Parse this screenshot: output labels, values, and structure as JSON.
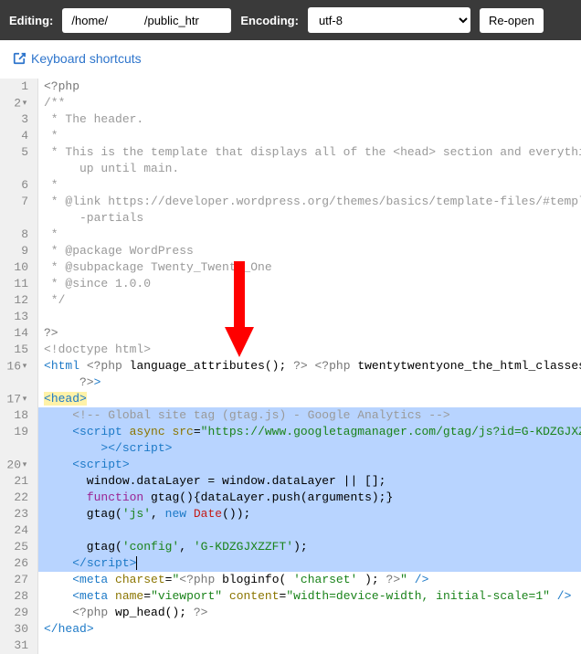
{
  "toolbar": {
    "editing_label": "Editing:",
    "path_value": "/home/           /public_htr",
    "encoding_label": "Encoding:",
    "encoding_value": "utf-8",
    "reopen_label": "Re-open"
  },
  "shortcuts_link": "Keyboard shortcuts",
  "code": {
    "l1": "<?php",
    "l2": "/**",
    "l3": " * The header.",
    "l4": " *",
    "l5": " * This is the template that displays all of the <head> section and everything",
    "l5b": "     up until main.",
    "l6": " *",
    "l7": " * @link https://developer.wordpress.org/themes/basics/template-files/#template",
    "l7b": "     -partials",
    "l8": " *",
    "l9": " * @package WordPress",
    "l10": " * @subpackage Twenty_Twenty_One",
    "l11": " * @since 1.0.0",
    "l12": " */",
    "l13": "",
    "l14": "?>",
    "l15": "<!doctype html>",
    "l16a": "<",
    "l16b": "html ",
    "l16c": "<?php",
    "l16d": " language_attributes(); ",
    "l16e": "?>",
    "l16f": " ",
    "l16g": "<?php",
    "l16h": " twentytwentyone_the_html_classes();",
    "l16i": "     ?>",
    "l16j": ">",
    "l17a": "<",
    "l17b": "head",
    "l17c": ">",
    "l18": "    <!-- Global site tag (gtag.js) - Google Analytics -->",
    "l19a": "    <",
    "l19b": "script ",
    "l19c": "async ",
    "l19d": "src",
    "l19e": "=",
    "l19f": "\"https://www.googletagmanager.com/gtag/js?id=G-KDZGJXZZFT\"",
    "l19g": "        ></",
    "l19h": "script",
    "l19i": ">",
    "l20a": "    <",
    "l20b": "script",
    "l20c": ">",
    "l21": "      window.dataLayer = window.dataLayer || [];",
    "l22a": "      ",
    "l22b": "function",
    "l22c": " gtag(){dataLayer.push(arguments);}",
    "l23a": "      gtag(",
    "l23b": "'js'",
    "l23c": ", ",
    "l23d": "new",
    "l23e": " ",
    "l23f": "Date",
    "l23g": "());",
    "l24": "",
    "l25a": "      gtag(",
    "l25b": "'config'",
    "l25c": ", ",
    "l25d": "'G-KDZGJXZZFT'",
    "l25e": ");",
    "l26a": "    </",
    "l26b": "script",
    "l26c": ">",
    "l27a": "    <",
    "l27b": "meta ",
    "l27c": "charset",
    "l27d": "=",
    "l27e": "\"",
    "l27f": "<?php",
    "l27g": " bloginfo( ",
    "l27h": "'charset'",
    "l27i": " ); ",
    "l27j": "?>",
    "l27k": "\"",
    "l27l": " />",
    "l28a": "    <",
    "l28b": "meta ",
    "l28c": "name",
    "l28d": "=",
    "l28e": "\"viewport\"",
    "l28f": " ",
    "l28g": "content",
    "l28h": "=",
    "l28i": "\"width=device-width, initial-scale=1\"",
    "l28j": " />",
    "l29a": "    ",
    "l29b": "<?php",
    "l29c": " wp_head(); ",
    "l29d": "?>",
    "l30a": "</",
    "l30b": "head",
    "l30c": ">",
    "l31": ""
  },
  "line_numbers": [
    "1",
    "2",
    "3",
    "4",
    "5",
    "",
    "6",
    "7",
    "",
    "8",
    "9",
    "10",
    "11",
    "12",
    "13",
    "14",
    "15",
    "16",
    "",
    "17",
    "18",
    "19",
    "",
    "20",
    "21",
    "22",
    "23",
    "24",
    "25",
    "26",
    "27",
    "28",
    "29",
    "30",
    "31"
  ]
}
